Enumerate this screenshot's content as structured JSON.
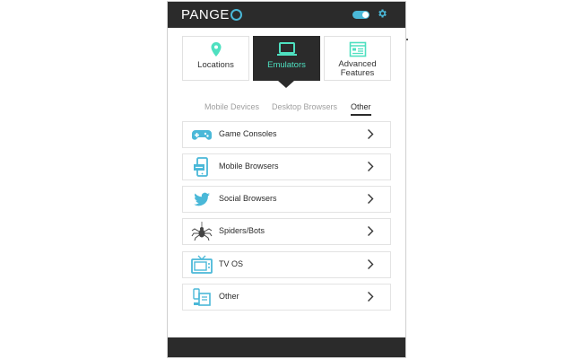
{
  "app": {
    "logo_text": "PANGE",
    "logo_last_letter": "O",
    "accent_color": "#4ab8d8",
    "active_text_color": "#4ee0c0",
    "dark_color": "#2b2b2b",
    "toggle_state": "on"
  },
  "header": {
    "toggle_icon": "toggle-switch-icon",
    "settings_icon": "gear-icon"
  },
  "main_tabs": [
    {
      "label": "Locations",
      "icon": "map-pin-icon",
      "active": false
    },
    {
      "label": "Emulators",
      "icon": "laptop-icon",
      "active": true
    },
    {
      "label": "Advanced Features",
      "label_line1": "Advanced",
      "label_line2": "Features",
      "icon": "window-settings-icon",
      "active": false
    }
  ],
  "sub_tabs": [
    {
      "label": "Mobile Devices",
      "active": false
    },
    {
      "label": "Desktop Browsers",
      "active": false
    },
    {
      "label": "Other",
      "active": true
    }
  ],
  "list_items": [
    {
      "label": "Game Consoles",
      "icon": "gamepad-icon"
    },
    {
      "label": "Mobile Browsers",
      "icon": "mobile-browser-icon"
    },
    {
      "label": "Social Browsers",
      "icon": "twitter-bird-icon"
    },
    {
      "label": "Spiders/Bots",
      "icon": "spider-icon"
    },
    {
      "label": "TV OS",
      "icon": "tv-icon"
    },
    {
      "label": "Other",
      "icon": "devices-icon"
    }
  ],
  "chevron_icon": "chevron-right-icon"
}
